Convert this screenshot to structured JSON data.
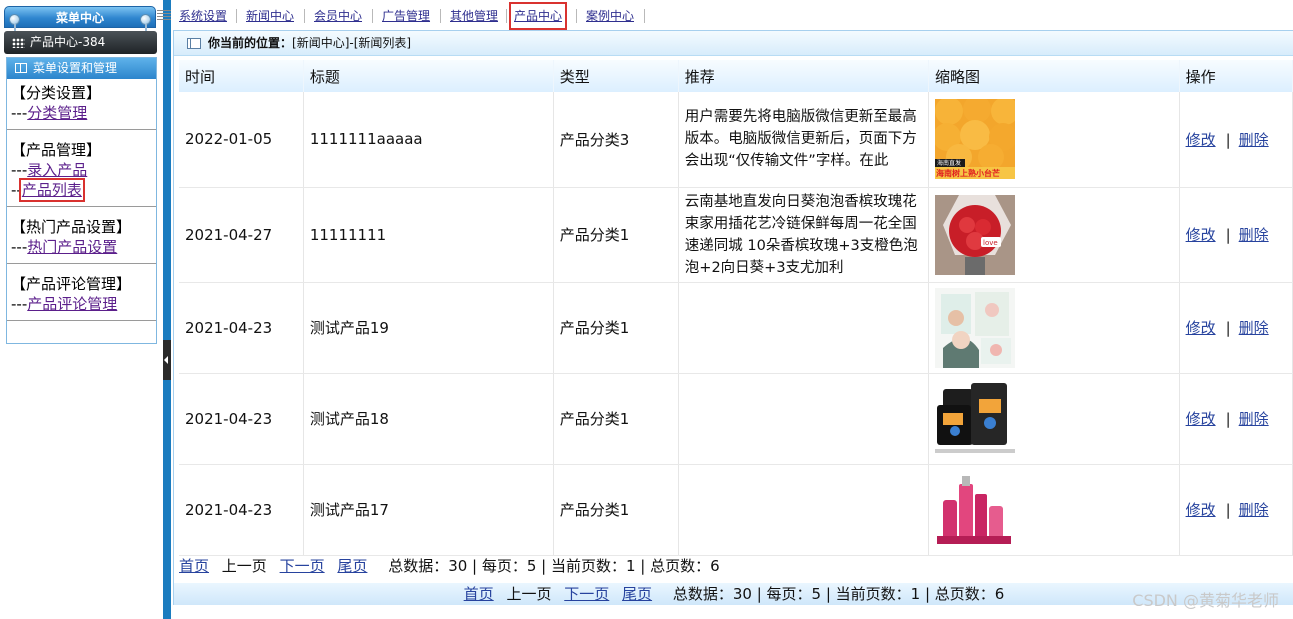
{
  "sidebar": {
    "header_title": "菜单中心",
    "module_label": "产品中心-384",
    "menu_title": "菜单设置和管理",
    "groups": [
      {
        "title": "【分类设置】",
        "items": [
          {
            "prefix": "---",
            "label": "分类管理"
          }
        ]
      },
      {
        "title": "【产品管理】",
        "items": [
          {
            "prefix": "---",
            "label": "录入产品"
          },
          {
            "prefix": "--",
            "label": "产品列表"
          }
        ]
      },
      {
        "title": "【热门产品设置】",
        "items": [
          {
            "prefix": "---",
            "label": "热门产品设置"
          }
        ]
      },
      {
        "title": "【产品评论管理】",
        "items": [
          {
            "prefix": "---",
            "label": "产品评论管理"
          }
        ]
      }
    ]
  },
  "topnav": {
    "items": [
      "系统设置",
      "新闻中心",
      "会员中心",
      "广告管理",
      "其他管理",
      "产品中心",
      "案例中心"
    ],
    "active_index": 5
  },
  "location": {
    "label": "你当前的位置：",
    "path": "[新闻中心]-[新闻列表]"
  },
  "table": {
    "headers": [
      "时间",
      "标题",
      "类型",
      "推荐",
      "缩略图",
      "操作"
    ],
    "rows": [
      {
        "date": "2022-01-05",
        "title": "1111111aaaaa",
        "type": "产品分类3",
        "rec": "用户需要先将电脑版微信更新至最高版本。电脑版微信更新后，页面下方会出现“仅传输文件”字样。在此",
        "thumb": "mango-image",
        "thumb_text_1": "海南直发",
        "thumb_text_2": "海南树上熟小台芒",
        "edit": "修改",
        "delete": "删除"
      },
      {
        "date": "2021-04-27",
        "title": "11111111",
        "type": "产品分类1",
        "rec": "云南基地直发向日葵泡泡香槟玫瑰花束家用插花艺冷链保鲜每周一花全国速递同城 10朵香槟玫瑰+3支橙色泡泡+2向日葵+3支尤加利",
        "thumb": "rose-bouquet-image",
        "thumb_text_1": "love",
        "thumb_text_2": "",
        "edit": "修改",
        "delete": "删除"
      },
      {
        "date": "2021-04-23",
        "title": "测试产品19",
        "type": "产品分类1",
        "rec": "",
        "thumb": "facial-mask-image",
        "thumb_text_1": "",
        "thumb_text_2": "",
        "edit": "修改",
        "delete": "删除"
      },
      {
        "date": "2021-04-23",
        "title": "测试产品18",
        "type": "产品分类1",
        "rec": "",
        "thumb": "black-box-product-image",
        "thumb_text_1": "",
        "thumb_text_2": "",
        "edit": "修改",
        "delete": "删除"
      },
      {
        "date": "2021-04-23",
        "title": "测试产品17",
        "type": "产品分类1",
        "rec": "",
        "thumb": "pink-cosmetics-image",
        "thumb_text_1": "",
        "thumb_text_2": "",
        "edit": "修改",
        "delete": "删除"
      }
    ]
  },
  "pager": {
    "first": "首页",
    "prev": "上一页",
    "next": "下一页",
    "last": "尾页",
    "summary": "总数据：30 | 每页：5 | 当前页数：1 | 总页数：6"
  },
  "watermark": "CSDN @黄菊华老师",
  "colors": {
    "accent": "#1b7cbf",
    "highlight": "#d9322f",
    "link": "#27439e"
  }
}
